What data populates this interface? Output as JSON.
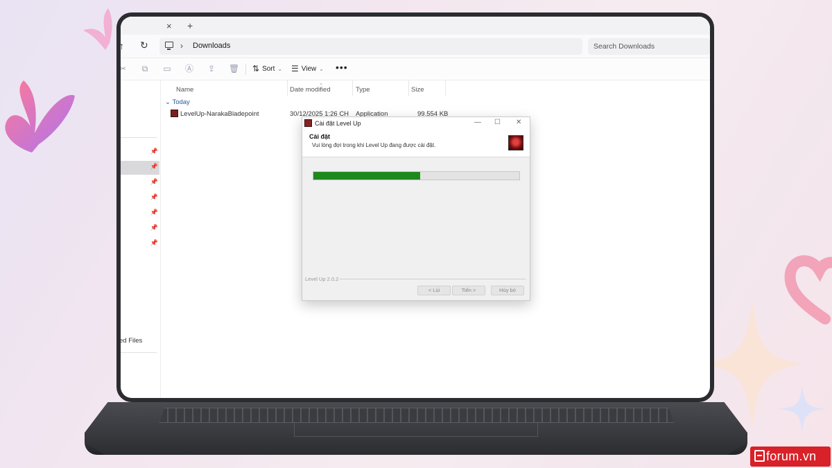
{
  "explorer": {
    "tab_close": "×",
    "tab_add": "+",
    "nav": {
      "up": "↑",
      "refresh": "↻",
      "chevron": "›"
    },
    "address": "Downloads",
    "search_placeholder": "Search Downloads",
    "toolbar": {
      "sort": "Sort",
      "view": "View",
      "more": "•••"
    },
    "columns": [
      "Name",
      "Date modified",
      "Type",
      "Size"
    ],
    "group": "Today",
    "files": [
      {
        "name": "LevelUp-NarakaBladepoint",
        "date": "30/12/2025 1:26 CH",
        "type": "Application",
        "size": "99.554 KB"
      }
    ],
    "sidebar_partial_label": "ed Files"
  },
  "installer": {
    "window_title": "Cài đặt Level Up",
    "header_title": "Cài đặt",
    "header_subtitle": "Vui lòng đợi trong khi Level Up đang được cài đặt.",
    "progress": 0.52,
    "brand": "Level Up 2.0.2",
    "buttons": {
      "back": "< Lùi",
      "next": "Tiến >",
      "cancel": "Hủy bỏ"
    },
    "controls": {
      "minimize": "—",
      "maximize": "☐",
      "close": "✕"
    }
  },
  "watermark": "forum.vn",
  "colors": {
    "progress_fill": "#1e8a1e",
    "watermark_bg": "#d82129"
  }
}
